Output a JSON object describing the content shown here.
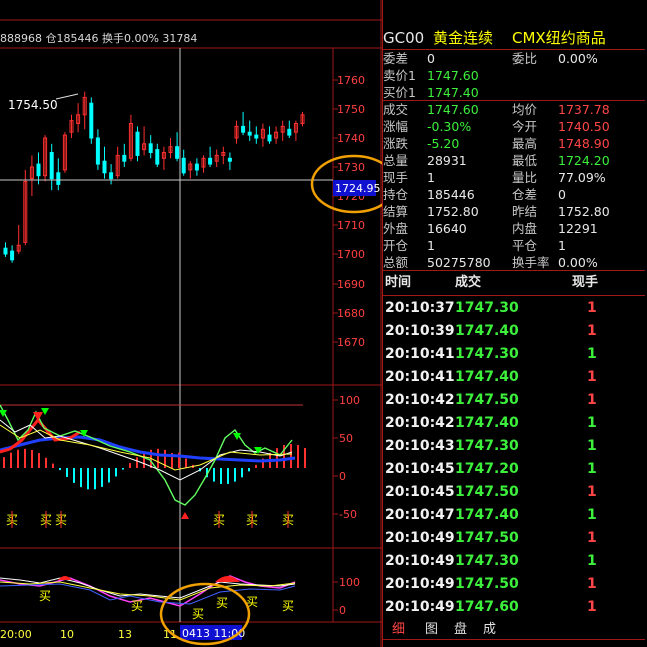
{
  "topbar": {
    "text": "888968 仓185446 换手0.00% 31784"
  },
  "quote": {
    "code": "GC00",
    "name": "黄金连续",
    "exchange": "CMX纽约商品",
    "rows": [
      {
        "l": "委差",
        "v": "0",
        "vc": "white",
        "l2": "委比",
        "v2": "0.00%",
        "v2c": "white"
      },
      {
        "l": "卖价1",
        "v": "1747.60",
        "vc": "green"
      },
      {
        "l": "买价1",
        "v": "1747.40",
        "vc": "green"
      },
      {
        "l": "成交",
        "v": "1747.60",
        "vc": "green",
        "l2": "均价",
        "v2": "1737.78",
        "v2c": "red"
      },
      {
        "l": "涨幅",
        "v": "-0.30%",
        "vc": "green",
        "l2": "今开",
        "v2": "1740.50",
        "v2c": "red"
      },
      {
        "l": "涨跌",
        "v": "-5.20",
        "vc": "green",
        "l2": "最高",
        "v2": "1748.90",
        "v2c": "red"
      },
      {
        "l": "总量",
        "v": "28931",
        "vc": "white",
        "l2": "最低",
        "v2": "1724.20",
        "v2c": "green"
      },
      {
        "l": "现手",
        "v": "1",
        "vc": "white",
        "l2": "量比",
        "v2": "77.09%",
        "v2c": "white"
      },
      {
        "l": "持仓",
        "v": "185446",
        "vc": "white",
        "l2": "仓差",
        "v2": "0",
        "v2c": "white"
      },
      {
        "l": "结算",
        "v": "1752.80",
        "vc": "white",
        "l2": "昨结",
        "v2": "1752.80",
        "v2c": "white"
      },
      {
        "l": "外盘",
        "v": "16640",
        "vc": "white",
        "l2": "内盘",
        "v2": "12291",
        "v2c": "white"
      },
      {
        "l": "开仓",
        "v": "1",
        "vc": "white",
        "l2": "平仓",
        "v2": "1",
        "v2c": "white"
      },
      {
        "l": "总额",
        "v": "50275780",
        "vc": "white",
        "l2": "换手率",
        "v2": "0.00%",
        "v2c": "white"
      }
    ]
  },
  "ticks": {
    "headers": [
      "时间",
      "成交",
      "现手"
    ],
    "rows": [
      {
        "t": "20:10:37",
        "p": "1747.30",
        "v": "1",
        "vc": "red"
      },
      {
        "t": "20:10:39",
        "p": "1747.40",
        "v": "1",
        "vc": "red"
      },
      {
        "t": "20:10:41",
        "p": "1747.30",
        "v": "1",
        "vc": "green"
      },
      {
        "t": "20:10:41",
        "p": "1747.40",
        "v": "1",
        "vc": "red"
      },
      {
        "t": "20:10:42",
        "p": "1747.50",
        "v": "1",
        "vc": "red"
      },
      {
        "t": "20:10:42",
        "p": "1747.40",
        "v": "1",
        "vc": "green"
      },
      {
        "t": "20:10:43",
        "p": "1747.30",
        "v": "1",
        "vc": "green"
      },
      {
        "t": "20:10:45",
        "p": "1747.20",
        "v": "1",
        "vc": "green"
      },
      {
        "t": "20:10:45",
        "p": "1747.50",
        "v": "1",
        "vc": "red"
      },
      {
        "t": "20:10:47",
        "p": "1747.40",
        "v": "1",
        "vc": "green"
      },
      {
        "t": "20:10:49",
        "p": "1747.50",
        "v": "1",
        "vc": "red"
      },
      {
        "t": "20:10:49",
        "p": "1747.30",
        "v": "1",
        "vc": "green"
      },
      {
        "t": "20:10:49",
        "p": "1747.50",
        "v": "1",
        "vc": "red"
      },
      {
        "t": "20:10:49",
        "p": "1747.60",
        "v": "1",
        "vc": "red"
      }
    ]
  },
  "tabs": [
    "细",
    "图",
    "盘",
    "成"
  ],
  "chart": {
    "price_axis": [
      "1760",
      "1750",
      "1740",
      "1730",
      "1720",
      "1710",
      "1700",
      "1690",
      "1680",
      "1670"
    ],
    "hilo_label": "1754.50",
    "cursor_price": "1724.95",
    "ind1_axis": [
      "100",
      "50",
      "0",
      "-50"
    ],
    "ind2_axis": [
      "100",
      "0"
    ],
    "date_labels": [
      "20:00",
      "10",
      "13",
      "11"
    ],
    "cursor_date": "0413 11:00",
    "signal_char": "买",
    "colors": {
      "up": "#ff3030",
      "down": "#00ffff",
      "grid": "#a01818",
      "cursor": "#c8c8c8"
    }
  }
}
